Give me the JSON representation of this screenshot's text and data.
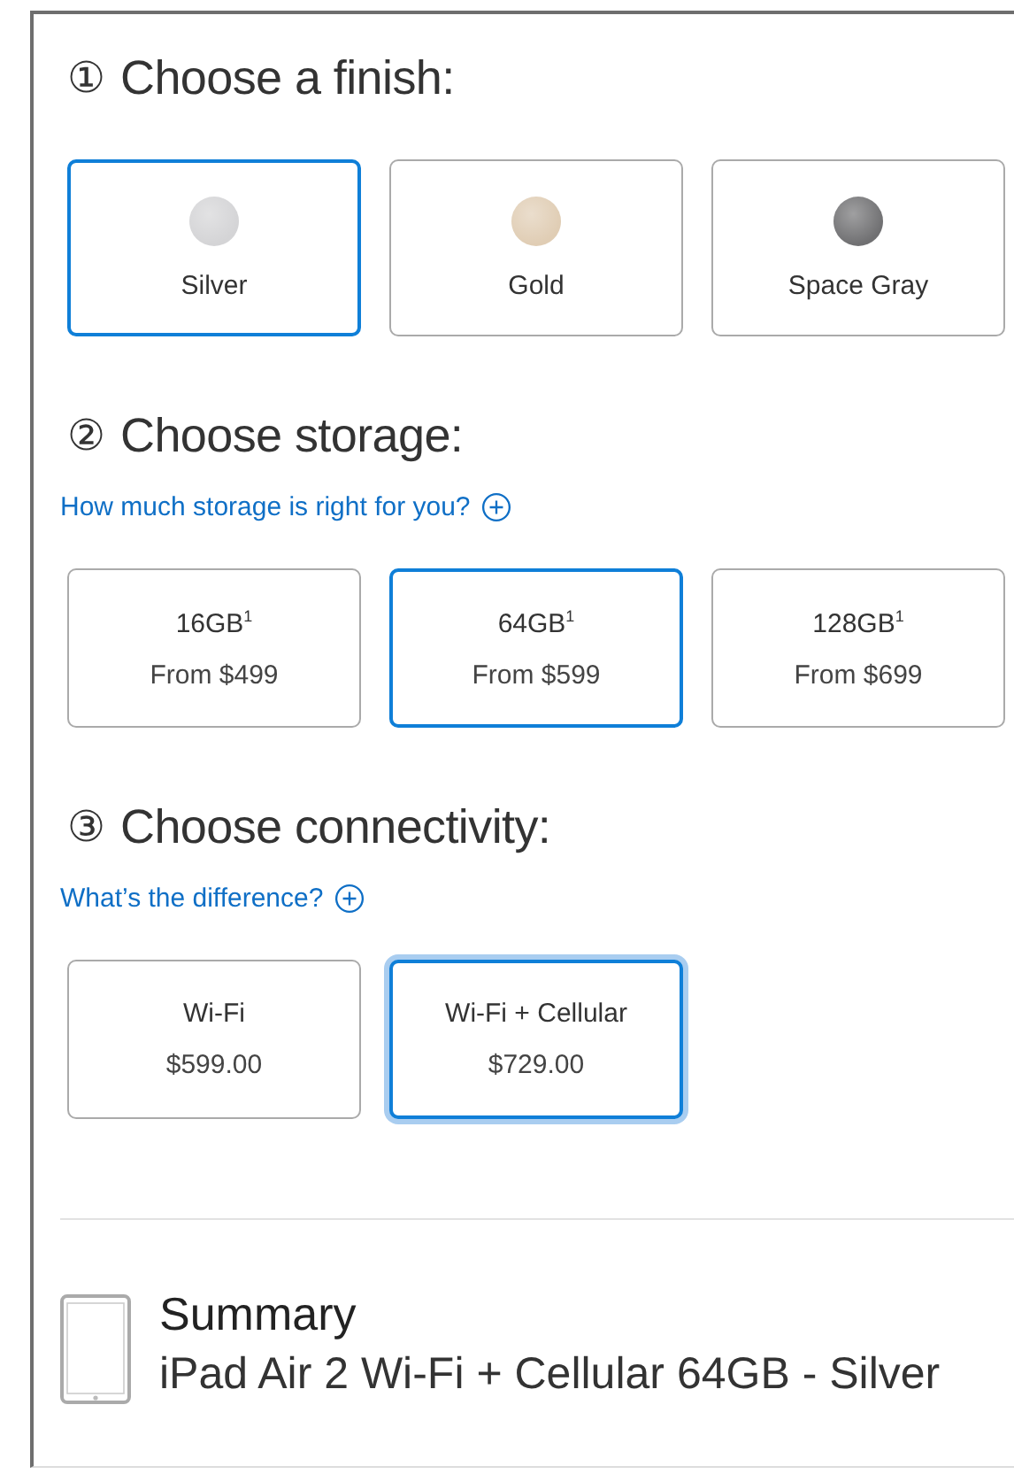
{
  "sections": [
    {
      "step": "①",
      "title": "Choose a finish:",
      "options": [
        {
          "kind": "swatch",
          "label": "Silver",
          "color": "#d4d4d6",
          "selected": true
        },
        {
          "kind": "swatch",
          "label": "Gold",
          "color": "#e0cdb4",
          "selected": false
        },
        {
          "kind": "swatch",
          "label": "Space Gray",
          "color": "#707072",
          "selected": false
        }
      ]
    },
    {
      "step": "②",
      "title": "Choose storage:",
      "help_link": "How much storage is right for you?",
      "options": [
        {
          "kind": "price",
          "label": "16GB$^{1}$",
          "price": "From $499",
          "selected": false
        },
        {
          "kind": "price",
          "label": "64GB$^{1}$",
          "price": "From $599",
          "selected": true
        },
        {
          "kind": "price",
          "label": "128GB$^{1}$",
          "price": "From $699",
          "selected": false
        }
      ]
    },
    {
      "step": "③",
      "title": "Choose connectivity:",
      "help_link": "What’s the difference?",
      "options": [
        {
          "kind": "price",
          "label": "Wi-Fi",
          "price": "$599.00",
          "selected": false
        },
        {
          "kind": "price",
          "label": "Wi-Fi + Cellular",
          "price": "$729.00",
          "selected": true
        }
      ]
    }
  ],
  "summary": {
    "title": "Summary",
    "product": "iPad Air 2 Wi-Fi + Cellular 64GB - Silver"
  }
}
